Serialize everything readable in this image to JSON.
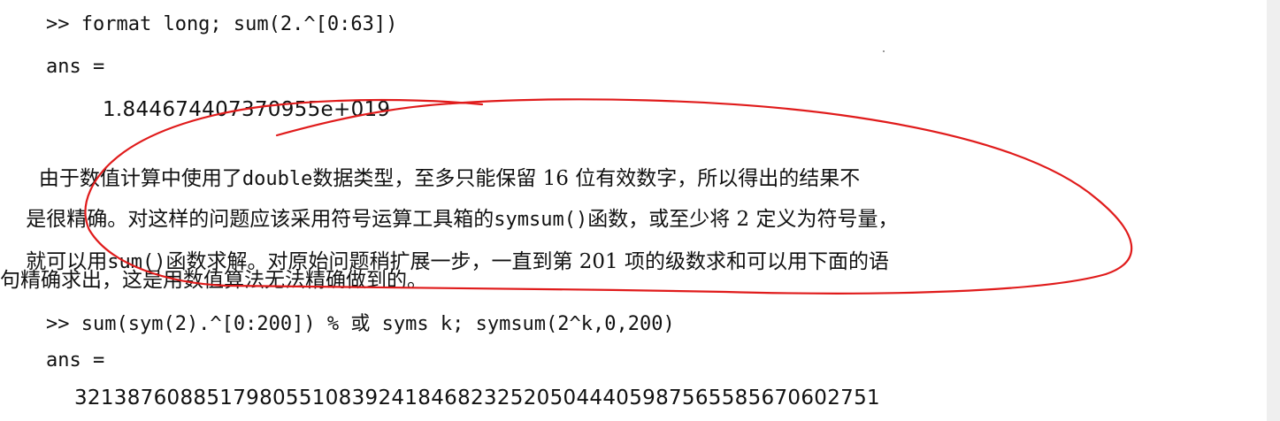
{
  "code_block_1": {
    "command": ">> format long; sum(2.^[0:63])",
    "ans_label": "ans =",
    "result": "1.844674407370955e+019"
  },
  "paragraph": {
    "line1_pre": "  由于数值计算中使用了",
    "line1_code": "double",
    "line1_post": "数据类型，至多只能保留 16 位有效数字，所以得出的结果不",
    "line2_pre": "是很精确。对这样的问题应该采用符号运算工具箱的",
    "line2_code": "symsum()",
    "line2_post": "函数，或至少将 2 定义为符号量，",
    "line3_pre": "就可以用",
    "line3_code": "sum()",
    "line3_post": "函数求解。对原始问题稍扩展一步，一直到第 201 项的级数求和可以用下面的语",
    "line4": "句精确求出，这是用数值算法无法精确做到的。"
  },
  "code_block_2": {
    "command": ">> sum(sym(2).^[0:200]) % 或 syms k; symsum(2^k,0,200)",
    "ans_label": "ans =",
    "result": "3213876088517980551083924184682325205044405987565585670602751"
  },
  "annotation": {
    "stroke_color": "#e01b1b"
  }
}
